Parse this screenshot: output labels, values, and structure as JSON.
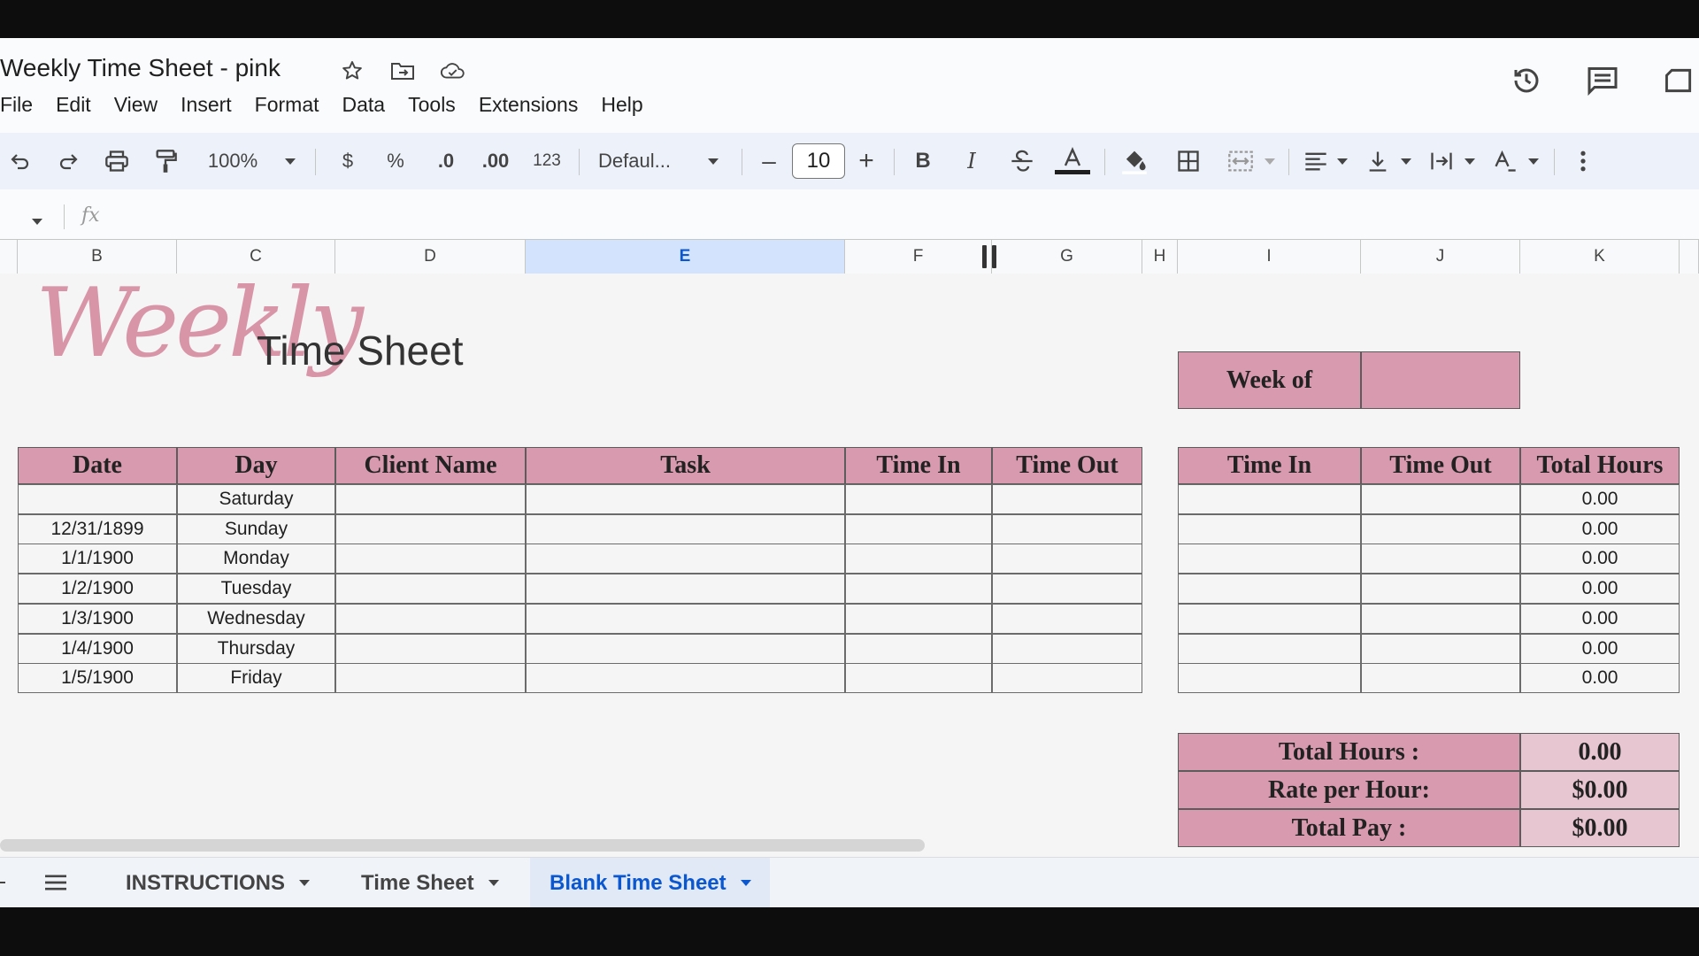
{
  "doc": {
    "title": "Weekly Time Sheet - pink"
  },
  "menu": [
    "File",
    "Edit",
    "View",
    "Insert",
    "Format",
    "Data",
    "Tools",
    "Extensions",
    "Help"
  ],
  "toolbar": {
    "zoom": "100%",
    "currency": "$",
    "percent": "%",
    "dec_decrease": ".0",
    "dec_increase": ".00",
    "number_format": "123",
    "font": "Defaul...",
    "font_size": "10",
    "bold": "B",
    "italic": "I"
  },
  "formula": {
    "fx": "fx"
  },
  "columns": [
    "B",
    "C",
    "D",
    "E",
    "F",
    "G",
    "H",
    "I",
    "J",
    "K"
  ],
  "selected_column": "E",
  "sheet": {
    "title_script": "Weekly",
    "title_sub": "Time Sheet",
    "week_of_label": "Week of",
    "week_of_value": "",
    "main_headers": [
      "Date",
      "Day",
      "Client Name",
      "Task",
      "Time In",
      "Time Out"
    ],
    "right_headers": [
      "Time In",
      "Time Out",
      "Total Hours"
    ],
    "rows": [
      {
        "date": "",
        "day": "Saturday",
        "total": "0.00"
      },
      {
        "date": "12/31/1899",
        "day": "Sunday",
        "total": "0.00"
      },
      {
        "date": "1/1/1900",
        "day": "Monday",
        "total": "0.00"
      },
      {
        "date": "1/2/1900",
        "day": "Tuesday",
        "total": "0.00"
      },
      {
        "date": "1/3/1900",
        "day": "Wednesday",
        "total": "0.00"
      },
      {
        "date": "1/4/1900",
        "day": "Thursday",
        "total": "0.00"
      },
      {
        "date": "1/5/1900",
        "day": "Friday",
        "total": "0.00"
      }
    ],
    "summary": [
      {
        "label": "Total Hours :",
        "value": "0.00"
      },
      {
        "label": "Rate per Hour:",
        "value": "$0.00"
      },
      {
        "label": "Total Pay :",
        "value": "$0.00"
      }
    ]
  },
  "tabs": [
    {
      "label": "INSTRUCTIONS",
      "active": false
    },
    {
      "label": "Time Sheet",
      "active": false
    },
    {
      "label": "Blank Time Sheet",
      "active": true
    }
  ],
  "colors": {
    "header_pink": "#d89aae",
    "value_pink": "#e8c6d1",
    "active_blue": "#0b57d0"
  }
}
